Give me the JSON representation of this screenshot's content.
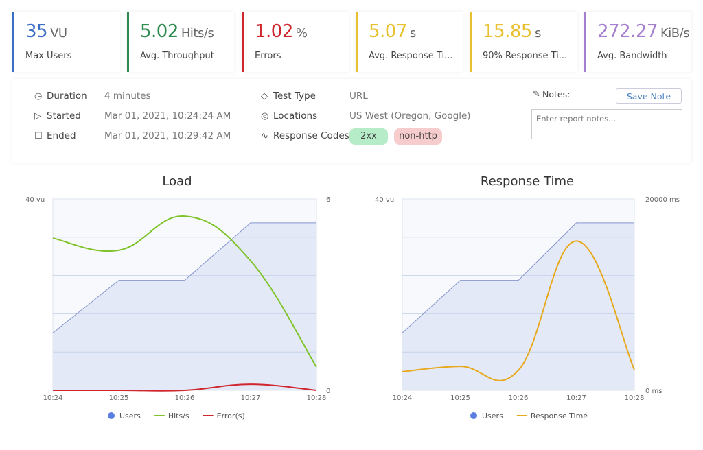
{
  "stats": [
    {
      "value": "35",
      "unit": "VU",
      "label": "Max Users",
      "color": "#3a6fc4"
    },
    {
      "value": "5.02",
      "unit": "Hits/s",
      "label": "Avg. Throughput",
      "color": "#2e8a4e"
    },
    {
      "value": "1.02",
      "unit": "%",
      "label": "Errors",
      "color": "#d0262e"
    },
    {
      "value": "5.07",
      "unit": "s",
      "label": "Avg. Response Ti...",
      "color": "#e8c030"
    },
    {
      "value": "15.85",
      "unit": "s",
      "label": "90% Response Ti...",
      "color": "#e8c030"
    },
    {
      "value": "272.27",
      "unit": "KiB/s",
      "label": "Avg. Bandwidth",
      "color": "#a57fcf"
    }
  ],
  "details": {
    "duration_label": "Duration",
    "duration": "4 minutes",
    "started_label": "Started",
    "started": "Mar 01, 2021, 10:24:24 AM",
    "ended_label": "Ended",
    "ended": "Mar 01, 2021, 10:29:42 AM",
    "test_type_label": "Test Type",
    "test_type": "URL",
    "locations_label": "Locations",
    "locations": "US West (Oregon, Google)",
    "codes_label": "Response Codes",
    "codes": [
      {
        "label": "2xx",
        "bg": "#b7ecc9"
      },
      {
        "label": "non-http",
        "bg": "#f7cccc"
      }
    ],
    "notes_label": "Notes:",
    "save_note": "Save Note",
    "notes_placeholder": "Enter report notes...",
    "notes_value": ""
  },
  "chart_data": [
    {
      "type": "line",
      "title": "Load",
      "categories": [
        "10:24",
        "10:25",
        "10:26",
        "10:27",
        "10:28"
      ],
      "y_left": {
        "range": [
          0,
          40
        ],
        "top_label": "40 vu"
      },
      "y_right": {
        "range": [
          0,
          6
        ],
        "labels": [
          "6",
          "0"
        ]
      },
      "grid": true,
      "legend": "bottom",
      "series": [
        {
          "name": "Users",
          "axis": "left",
          "style": "area",
          "color": "#5a7fe0",
          "values": [
            12,
            23,
            23,
            35,
            35
          ]
        },
        {
          "name": "Hits/s",
          "axis": "right",
          "color": "#7ec32a",
          "values": [
            4.77,
            4.39,
            5.46,
            4.06,
            0.73
          ]
        },
        {
          "name": "Error(s)",
          "axis": "right",
          "color": "#d0262e",
          "values": [
            0,
            0,
            0,
            0.19,
            0
          ]
        }
      ]
    },
    {
      "type": "line",
      "title": "Response Time",
      "categories": [
        "10:24",
        "10:25",
        "10:26",
        "10:27",
        "10:28"
      ],
      "y_left": {
        "range": [
          0,
          40
        ],
        "top_label": "40 vu"
      },
      "y_right": {
        "range": [
          0,
          20000
        ],
        "labels": [
          "20000 ms",
          "0 ms"
        ]
      },
      "grid": true,
      "legend": "bottom",
      "series": [
        {
          "name": "Users",
          "axis": "left",
          "style": "area",
          "color": "#5a7fe0",
          "values": [
            12,
            23,
            23,
            35,
            35
          ]
        },
        {
          "name": "Response Time",
          "axis": "right",
          "color": "#e8a81c",
          "values": [
            1950,
            2500,
            2080,
            15600,
            2150
          ]
        }
      ]
    }
  ]
}
